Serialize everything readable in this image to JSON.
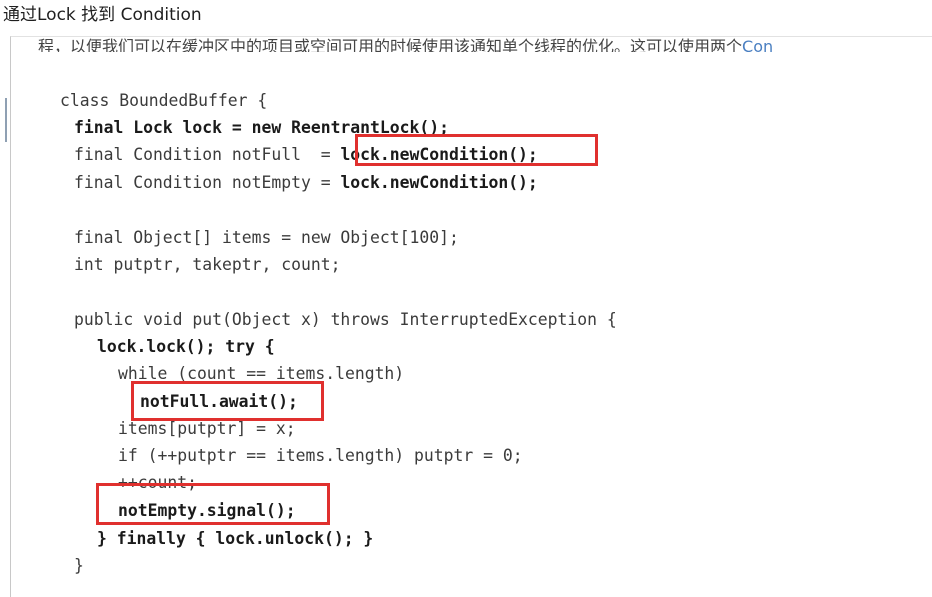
{
  "heading": "通过Lock 找到 Condition",
  "intro_cut": "程，以便我们可以在缓冲区中的项目或空间可用的时候使用该通知单个线程的优化。这可以使用两个",
  "intro_link_tail": "Con",
  "code": [
    {
      "plain": "class BoundedBuffer {",
      "bold": ""
    },
    {
      "plain": "",
      "bold": "final Lock lock = new ReentrantLock();"
    },
    {
      "plain": "final Condition notFull  = ",
      "bold": "lock.newCondition();"
    },
    {
      "plain": "final Condition notEmpty = ",
      "bold": "lock.newCondition();"
    },
    {
      "plain": "final Object[] items = new Object[100];",
      "bold": ""
    },
    {
      "plain": "int putptr, takeptr, count;",
      "bold": ""
    },
    {
      "plain": "public void put(Object x) throws InterruptedException {",
      "bold": ""
    },
    {
      "plain": "",
      "bold": "lock.lock(); try {"
    },
    {
      "plain": "while (count == items.length)",
      "bold": ""
    },
    {
      "plain": "",
      "bold": "notFull.await();"
    },
    {
      "plain": "items[putptr] = x;",
      "bold": ""
    },
    {
      "plain": "if (++putptr == items.length) putptr = 0;",
      "bold": ""
    },
    {
      "plain": "++count;",
      "bold": ""
    },
    {
      "plain": "",
      "bold": "notEmpty.signal();"
    },
    {
      "plain": "",
      "bold": "} finally { lock.unlock(); }"
    },
    {
      "plain": "}",
      "bold": ""
    }
  ],
  "highlight_color": "#e0302e"
}
